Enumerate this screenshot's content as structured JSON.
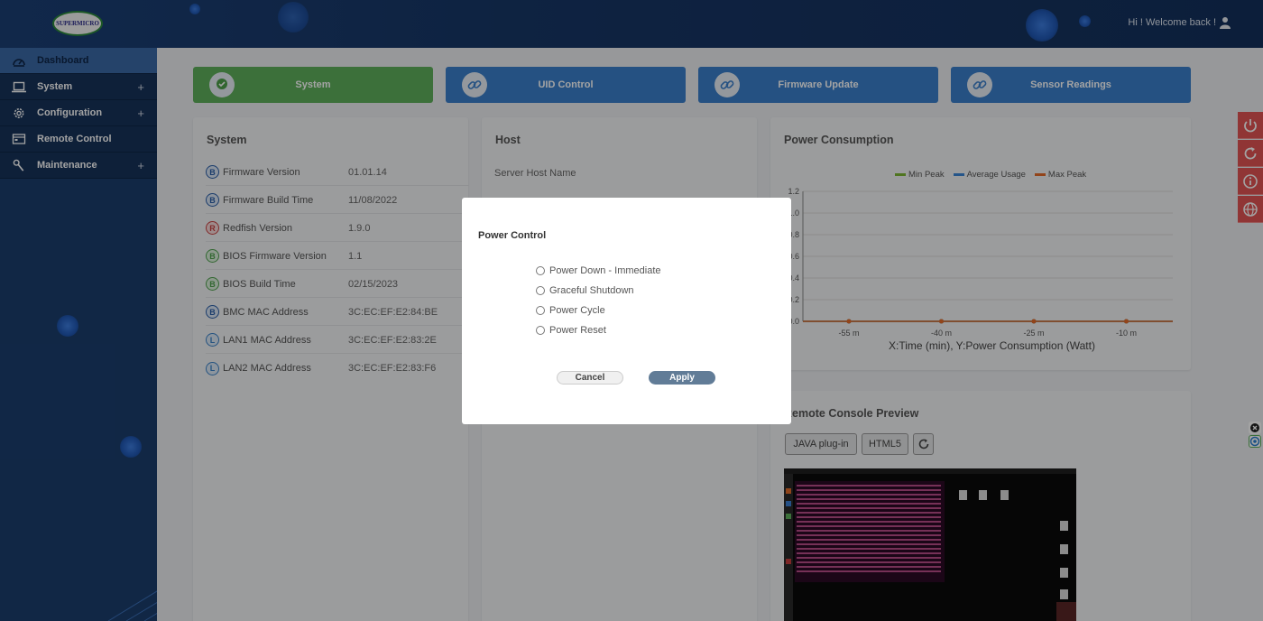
{
  "header": {
    "logo_text": "SUPERMICRO",
    "welcome": "Hi ! Welcome back !",
    "user_icon": "user-icon"
  },
  "sidebar": {
    "items": [
      {
        "label": "Dashboard",
        "icon": "dashboard-icon",
        "expandable": false,
        "active": true
      },
      {
        "label": "System",
        "icon": "laptop-icon",
        "expandable": true,
        "active": false
      },
      {
        "label": "Configuration",
        "icon": "gear-icon",
        "expandable": true,
        "active": false
      },
      {
        "label": "Remote Control",
        "icon": "console-window-icon",
        "expandable": false,
        "active": false
      },
      {
        "label": "Maintenance",
        "icon": "wrench-icon",
        "expandable": true,
        "active": false
      }
    ],
    "plus_symbol": "+"
  },
  "tabs": [
    {
      "label": "System",
      "icon": "chat-bubble-check-icon",
      "color": "#5fb05c"
    },
    {
      "label": "UID Control",
      "icon": "link-icon",
      "color": "#3a7fcc"
    },
    {
      "label": "Firmware Update",
      "icon": "link-icon",
      "color": "#3a7fcc"
    },
    {
      "label": "Sensor Readings",
      "icon": "link-icon",
      "color": "#3a7fcc"
    }
  ],
  "system_card": {
    "title": "System",
    "rows": [
      {
        "badge": "B",
        "badge_color": "blue",
        "label": "Firmware Version",
        "value": "01.01.14"
      },
      {
        "badge": "B",
        "badge_color": "blue",
        "label": "Firmware Build Time",
        "value": "11/08/2022"
      },
      {
        "badge": "R",
        "badge_color": "red",
        "label": "Redfish Version",
        "value": "1.9.0"
      },
      {
        "badge": "B",
        "badge_color": "green",
        "label": "BIOS Firmware Version",
        "value": "1.1"
      },
      {
        "badge": "B",
        "badge_color": "green",
        "label": "BIOS Build Time",
        "value": "02/15/2023"
      },
      {
        "badge": "B",
        "badge_color": "blue",
        "label": "BMC MAC Address",
        "value": "3C:EC:EF:E2:84:BE"
      },
      {
        "badge": "L",
        "badge_color": "lblue",
        "label": "LAN1 MAC Address",
        "value": "3C:EC:EF:E2:83:2E"
      },
      {
        "badge": "L",
        "badge_color": "lblue",
        "label": "LAN2 MAC Address",
        "value": "3C:EC:EF:E2:83:F6"
      }
    ]
  },
  "host_card": {
    "title": "Host",
    "rows": [
      "Server Host Name"
    ]
  },
  "power_card": {
    "title": "Power Consumption",
    "legend": [
      {
        "name": "Min Peak",
        "color": "#7cb832"
      },
      {
        "name": "Average Usage",
        "color": "#3a86d6"
      },
      {
        "name": "Max Peak",
        "color": "#e46b2a"
      }
    ],
    "caption": "X:Time (min), Y:Power Consumption (Watt)"
  },
  "chart_data": {
    "type": "line",
    "title": "Power Consumption",
    "xlabel": "X:Time (min)",
    "ylabel": "Y:Power Consumption (Watt)",
    "x": [
      "-55 m",
      "-40 m",
      "-25 m",
      "-10 m"
    ],
    "y_ticks": [
      "1.2",
      "1.0",
      "0.8",
      "0.6",
      "0.4",
      "0.2",
      "0.0"
    ],
    "ylim": [
      0,
      1.2
    ],
    "series": [
      {
        "name": "Min Peak",
        "values": [
          0,
          0,
          0,
          0
        ],
        "color": "#7cb832"
      },
      {
        "name": "Average Usage",
        "values": [
          0,
          0,
          0,
          0
        ],
        "color": "#3a86d6"
      },
      {
        "name": "Max Peak",
        "values": [
          0,
          0,
          0,
          0
        ],
        "color": "#e46b2a"
      }
    ],
    "legend_position": "top",
    "grid": true
  },
  "remote_console": {
    "title": "Remote Console Preview",
    "java_label": "JAVA plug-in",
    "html5_label": "HTML5",
    "refresh_icon": "refresh-icon"
  },
  "right_controls": [
    "power-icon",
    "refresh-icon",
    "info-icon",
    "globe-icon"
  ],
  "modal": {
    "title": "Power Control",
    "options": [
      "Power Down - Immediate",
      "Graceful Shutdown",
      "Power Cycle",
      "Power Reset"
    ],
    "cancel_label": "Cancel",
    "apply_label": "Apply"
  }
}
